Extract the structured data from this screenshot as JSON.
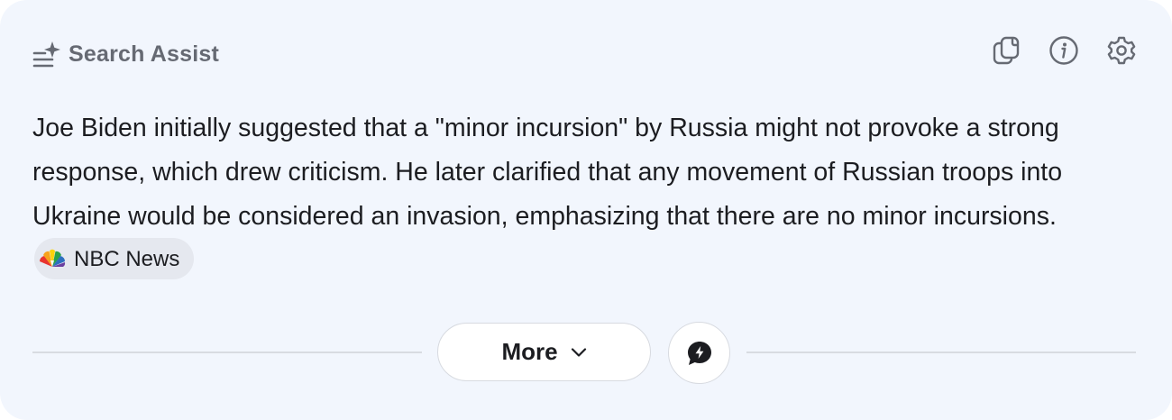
{
  "panel": {
    "title": "Search Assist",
    "title_icon": "sparkle-list-icon"
  },
  "toolbar": {
    "icons": [
      "copy-icon",
      "info-icon",
      "settings-icon"
    ]
  },
  "answer": {
    "text": "Joe Biden initially suggested that a \"minor incursion\" by Russia might not provoke a strong response, which drew criticism. He later clarified that any movement of Russian troops into Ukraine would be considered an invasion, emphasizing that there are no minor incursions.",
    "source": {
      "label": "NBC News",
      "icon": "nbc-peacock-icon"
    }
  },
  "actions": {
    "more_label": "More",
    "more_icon": "chevron-down-icon",
    "chat_icon": "chat-bubble-icon"
  },
  "colors": {
    "background": "#f2f6fd",
    "text": "#1c1d21",
    "header_text": "#666a73",
    "chip_background": "#e5e8ef",
    "divider": "#d8dbe1"
  }
}
